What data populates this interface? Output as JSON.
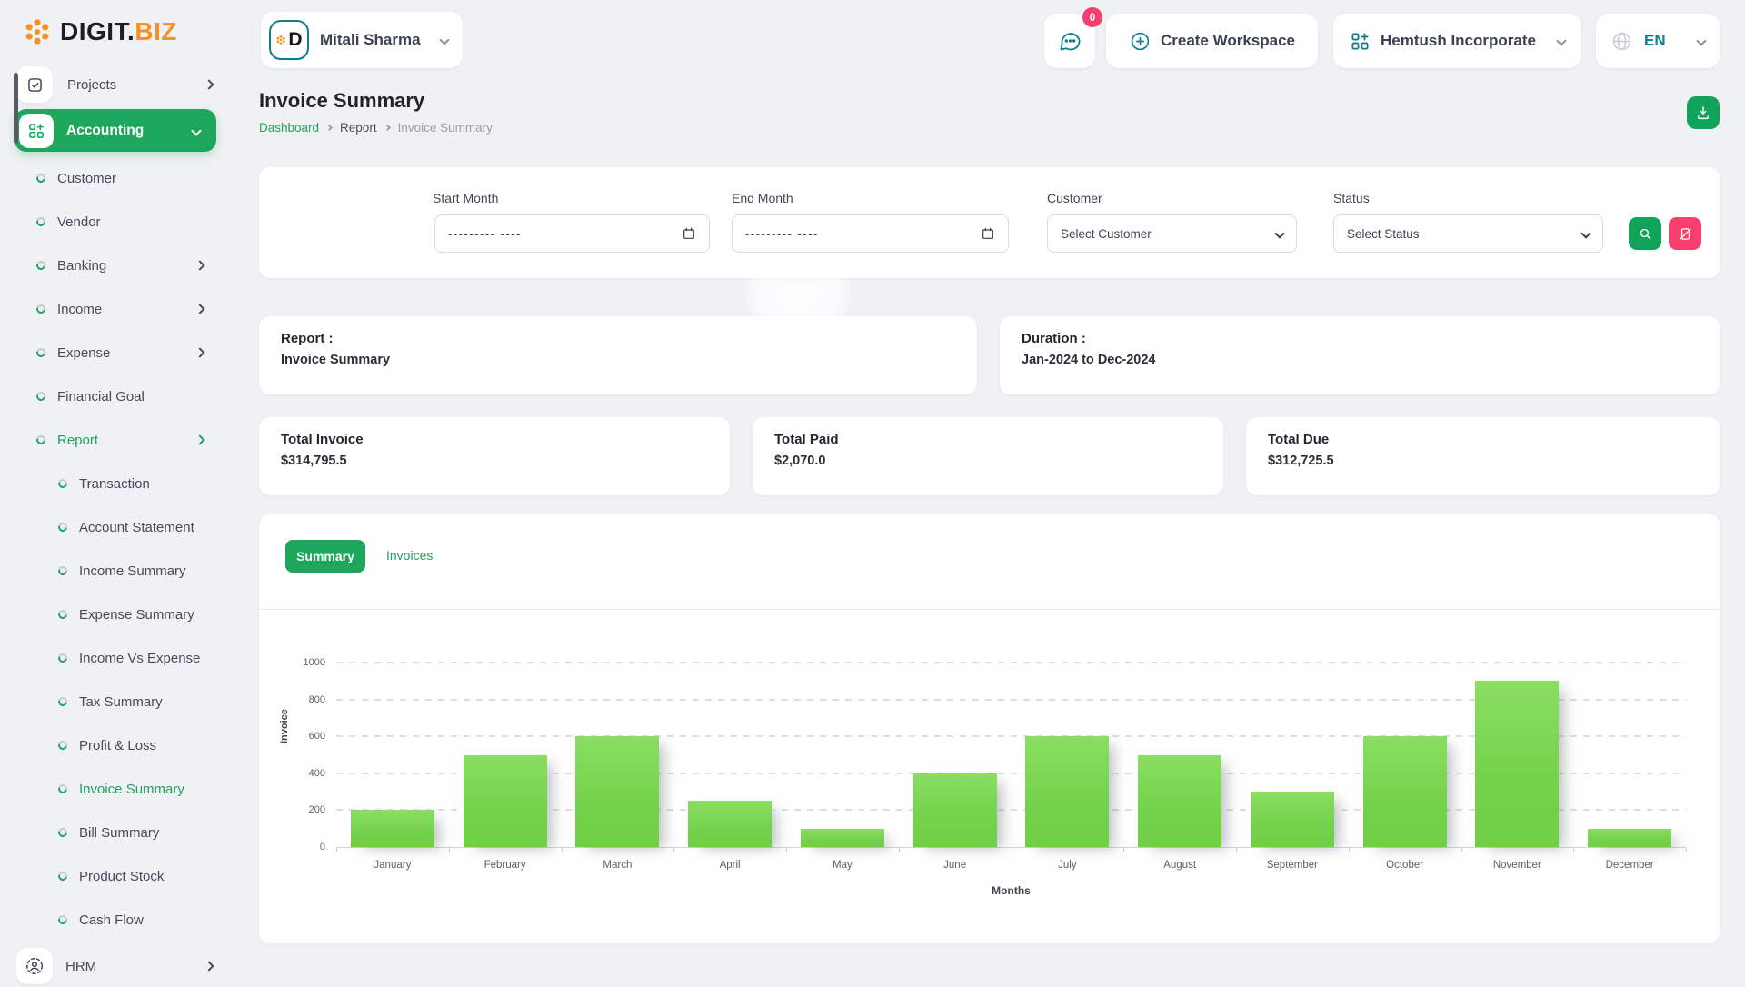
{
  "brand": {
    "primary": "DIGIT.",
    "secondary": "BIZ"
  },
  "header": {
    "user": {
      "name": "Mitali Sharma",
      "avatar_letter": "D"
    },
    "chat": {
      "badge": "0"
    },
    "create_workspace": {
      "label": "Create Workspace"
    },
    "workspace": {
      "label": "Hemtush Incorporate"
    },
    "language": {
      "label": "EN"
    }
  },
  "sidebar": {
    "projects": {
      "label": "Projects"
    },
    "accounting": {
      "label": "Accounting"
    },
    "items": [
      {
        "label": "Customer"
      },
      {
        "label": "Vendor"
      },
      {
        "label": "Banking"
      },
      {
        "label": "Income"
      },
      {
        "label": "Expense"
      },
      {
        "label": "Financial Goal"
      },
      {
        "label": "Report"
      },
      {
        "label": "Transaction"
      },
      {
        "label": "Account Statement"
      },
      {
        "label": "Income Summary"
      },
      {
        "label": "Expense Summary"
      },
      {
        "label": "Income Vs Expense"
      },
      {
        "label": "Tax Summary"
      },
      {
        "label": "Profit & Loss"
      },
      {
        "label": "Invoice Summary"
      },
      {
        "label": "Bill Summary"
      },
      {
        "label": "Product Stock"
      },
      {
        "label": "Cash Flow"
      }
    ],
    "hrm": {
      "label": "HRM"
    }
  },
  "page": {
    "title": "Invoice Summary",
    "breadcrumb": {
      "home": "Dashboard",
      "section": "Report",
      "current": "Invoice Summary"
    }
  },
  "filters": {
    "start_month": {
      "label": "Start Month",
      "value": "--------- ----"
    },
    "end_month": {
      "label": "End Month",
      "value": "--------- ----"
    },
    "customer": {
      "label": "Customer",
      "value": "Select Customer"
    },
    "status": {
      "label": "Status",
      "value": "Select Status"
    }
  },
  "report_info": {
    "label": "Report :",
    "value": "Invoice Summary"
  },
  "duration_info": {
    "label": "Duration :",
    "value": "Jan-2024 to Dec-2024"
  },
  "totals": [
    {
      "label": "Total Invoice",
      "value": "$314,795.5"
    },
    {
      "label": "Total Paid",
      "value": "$2,070.0"
    },
    {
      "label": "Total Due",
      "value": "$312,725.5"
    }
  ],
  "tabs": {
    "summary": "Summary",
    "invoices": "Invoices"
  },
  "chart_data": {
    "type": "bar",
    "categories": [
      "January",
      "February",
      "March",
      "April",
      "May",
      "June",
      "July",
      "August",
      "September",
      "October",
      "November",
      "December"
    ],
    "values": [
      200,
      500,
      600,
      250,
      100,
      400,
      600,
      500,
      300,
      600,
      900,
      100
    ],
    "xlabel": "Months",
    "ylabel": "Invoice",
    "ylim": [
      0,
      1000
    ],
    "yticks": [
      0,
      200,
      400,
      600,
      800,
      1000
    ],
    "grid": "horizontal-dashed",
    "legend": "none",
    "bar_color": "#77D44F"
  },
  "colors": {
    "accent_green": "#1CA75C",
    "teal": "#0E7E8D",
    "pink": "#F73E6C",
    "orange": "#F6921E",
    "bar_green": "#77D44F"
  }
}
